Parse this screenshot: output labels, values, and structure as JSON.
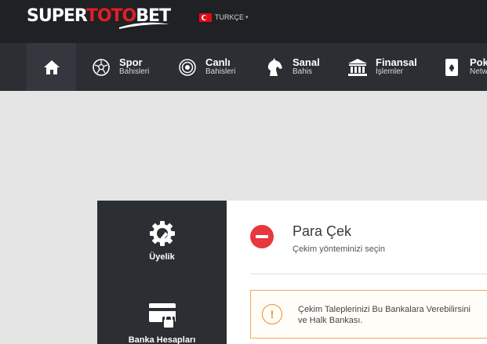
{
  "header": {
    "logo": {
      "part1": "SUPER",
      "part2": "TOTO",
      "part3": "BET"
    },
    "language": {
      "label": "TURKÇE",
      "caret": "▾",
      "flag": "turkey-flag"
    }
  },
  "nav": {
    "home_icon": "home-icon",
    "items": [
      {
        "title": "Spor",
        "sub": "Bahisleri",
        "icon": "soccer-ball-icon"
      },
      {
        "title": "Canlı",
        "sub": "Bahisleri",
        "icon": "live-icon"
      },
      {
        "title": "Sanal",
        "sub": "Bahis",
        "icon": "horse-icon"
      },
      {
        "title": "Finansal",
        "sub": "İşlemler",
        "icon": "bank-icon"
      },
      {
        "title": "Pok",
        "sub": "Netw",
        "icon": "playing-card-icon"
      }
    ]
  },
  "sidebar": {
    "items": [
      {
        "label": "Üyelik",
        "icon": "gear-wrench-icon"
      },
      {
        "label": "Banka Hesapları",
        "icon": "card-lock-icon"
      }
    ]
  },
  "main": {
    "title": "Para Çek",
    "subtitle": "Çekim yönteminizi seçin",
    "warning": {
      "icon_text": "!",
      "line1": "Çekim Taleplerinizi Bu Bankalara Verebilirsini",
      "line2": "ve Halk Bankası."
    }
  },
  "colors": {
    "brand_red": "#e01f26",
    "topbar": "#1f2124",
    "navbar": "#2b2e33",
    "warning": "#f08c25"
  }
}
